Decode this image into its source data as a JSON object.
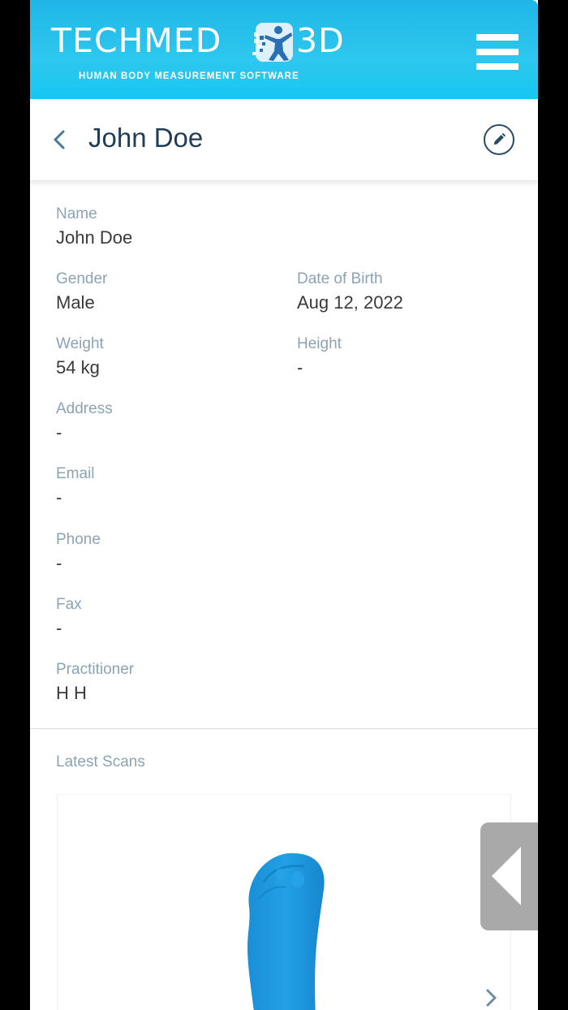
{
  "header": {
    "logo_left": "TECHMED",
    "logo_right": "3D",
    "tagline": "HUMAN BODY MEASUREMENT SOFTWARE",
    "logo_icon": "human-figure-logo-icon",
    "menu_icon": "hamburger-menu-icon",
    "color": "#1fb6e6"
  },
  "patient": {
    "title": "John Doe",
    "back_icon": "chevron-left-icon",
    "edit_icon": "pencil-icon"
  },
  "details": {
    "name": {
      "label": "Name",
      "value": "John Doe"
    },
    "gender": {
      "label": "Gender",
      "value": "Male"
    },
    "dob": {
      "label": "Date of Birth",
      "value": "Aug 12, 2022"
    },
    "weight": {
      "label": "Weight",
      "value": "54 kg"
    },
    "height": {
      "label": "Height",
      "value": "-"
    },
    "address": {
      "label": "Address",
      "value": "-"
    },
    "email": {
      "label": "Email",
      "value": "-"
    },
    "phone": {
      "label": "Phone",
      "value": "-"
    },
    "fax": {
      "label": "Fax",
      "value": "-"
    },
    "practitioner": {
      "label": "Practitioner",
      "value": "H H"
    }
  },
  "scans": {
    "title": "Latest Scans",
    "scan_icon": "foot-scan-image",
    "next_icon": "chevron-right-icon",
    "scan_color": "#1a8fd8"
  },
  "side_tab": {
    "icon": "triangle-left-icon"
  }
}
